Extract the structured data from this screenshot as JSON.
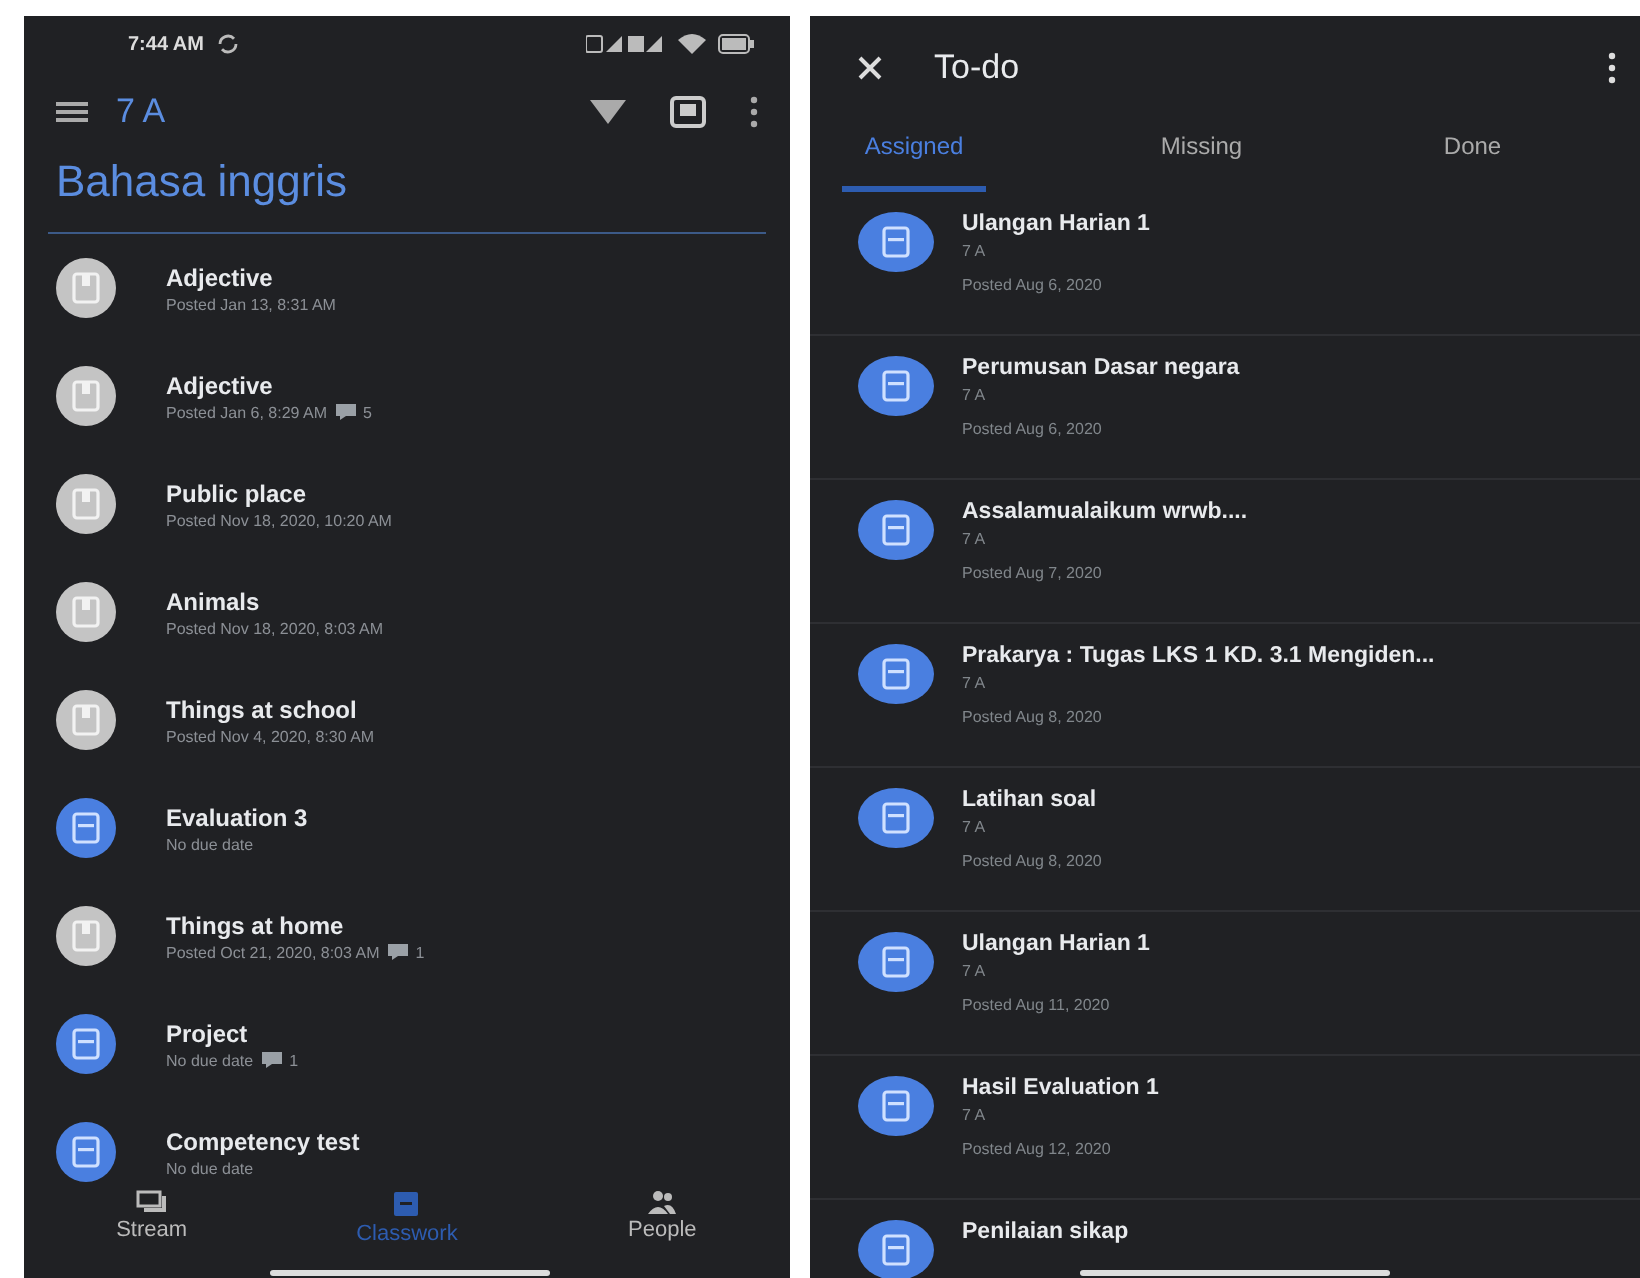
{
  "left": {
    "status_bar": {
      "time": "7:44 AM"
    },
    "toolbar": {
      "class_name": "7 A"
    },
    "topic": "Bahasa inggris",
    "items": [
      {
        "kind": "material",
        "title": "Adjective",
        "subtitle": "Posted Jan 13, 8:31 AM"
      },
      {
        "kind": "material",
        "title": "Adjective",
        "subtitle": "Posted Jan 6, 8:29 AM",
        "comments": "5"
      },
      {
        "kind": "material",
        "title": "Public place",
        "subtitle": "Posted Nov 18, 2020, 10:20 AM"
      },
      {
        "kind": "material",
        "title": "Animals",
        "subtitle": "Posted Nov 18, 2020, 8:03 AM"
      },
      {
        "kind": "material",
        "title": "Things at school",
        "subtitle": "Posted Nov 4, 2020, 8:30 AM"
      },
      {
        "kind": "assignment",
        "title": "Evaluation 3",
        "subtitle": "No due date"
      },
      {
        "kind": "material",
        "title": "Things at home",
        "subtitle": "Posted Oct 21, 2020, 8:03 AM",
        "comments": "1"
      },
      {
        "kind": "assignment",
        "title": "Project",
        "subtitle": "No due date",
        "comments": "1"
      },
      {
        "kind": "assignment",
        "title": "Competency test",
        "subtitle": "No due date"
      }
    ],
    "bottom_nav": [
      {
        "kind": "stream",
        "label": "Stream",
        "selected": false
      },
      {
        "kind": "classwork",
        "label": "Classwork",
        "selected": true
      },
      {
        "kind": "people",
        "label": "People",
        "selected": false
      }
    ]
  },
  "right": {
    "header": {
      "title": "To-do"
    },
    "tabs": [
      {
        "label": "Assigned",
        "selected": true
      },
      {
        "label": "Missing",
        "selected": false
      },
      {
        "label": "Done",
        "selected": false
      }
    ],
    "items": [
      {
        "title": "Ulangan Harian 1",
        "class_name": "7 A",
        "posted": "Posted Aug 6, 2020"
      },
      {
        "title": "Perumusan Dasar negara",
        "class_name": "7 A",
        "posted": "Posted Aug 6, 2020"
      },
      {
        "title": "Assalamualaikum wrwb....",
        "class_name": "7 A",
        "posted": "Posted Aug 7, 2020"
      },
      {
        "title": "Prakarya : Tugas LKS 1 KD. 3.1 Mengiden...",
        "class_name": "7 A",
        "posted": "Posted Aug 8, 2020"
      },
      {
        "title": "Latihan soal",
        "class_name": "7 A",
        "posted": "Posted Aug 8, 2020"
      },
      {
        "title": "Ulangan Harian 1",
        "class_name": "7 A",
        "posted": "Posted Aug 11, 2020"
      },
      {
        "title": "Hasil Evaluation 1",
        "class_name": "7 A",
        "posted": "Posted Aug 12, 2020"
      },
      {
        "title": "Penilaian sikap"
      }
    ]
  }
}
